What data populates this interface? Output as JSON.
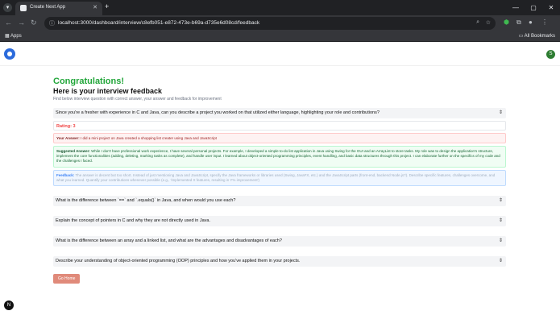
{
  "browser": {
    "tab_title": "Create Next App",
    "url": "localhost:3000/dashboard/interview/c8efb051-e872-473e-b69a-d735e6d08cd/feedback",
    "bookmarks_apps": "Apps",
    "bookmarks_all": "All Bookmarks"
  },
  "header": {
    "avatar_initial": "S"
  },
  "page": {
    "congrats": "Congratulations!",
    "title": "Here is your interview feedback",
    "subtitle": "Find below interview question with correct answer, your answer and feedback for improvement"
  },
  "expanded": {
    "question": "Since you're a fresher with experience in C and Java, can you describe a project you worked on that utilized either language, highlighting your role and contributions?",
    "rating_label": "Rating:",
    "rating_value": "3",
    "your_answer_label": "Your Answer:",
    "your_answer": "I did a mini project on Java created a shopping list creater using Java and JavaScript",
    "suggested_label": "Suggested Answer:",
    "suggested_answer": "While I don't have professional work experience, I have several personal projects. For example, I developed a simple to-do list application in Java using Swing for the GUI and an ArrayList to store tasks. My role was to design the application's structure, implement the core functionalities (adding, deleting, marking tasks as complete), and handle user input. I learned about object-oriented programming principles, event handling, and basic data structures through this project. I can elaborate further on the specifics of my code and the challenges I faced.",
    "feedback_label": "Feedback:",
    "feedback": "The answer is decent but too short. Instead of just mentioning Java and JavaScript, specify the Java frameworks or libraries used (Swing, JavaFX, etc.) and the JavaScript parts (front-end, backend Node.js?). Describe specific features, challenges overcome, and what you learned. Quantify your contributions whenever possible (e.g., 'implemented X features, resulting in Y% improvement')"
  },
  "questions": [
    "What is the difference between `==` and `.equals()` in Java, and when would you use each?",
    "Explain the concept of pointers in C and why they are not directly used in Java.",
    "What is the difference between an array and a linked list, and what are the advantages and disadvantages of each?",
    "Describe your understanding of object-oriented programming (OOP) principles and how you've applied them in your projects."
  ],
  "go_home_label": "Go Home",
  "fab_label": "N"
}
